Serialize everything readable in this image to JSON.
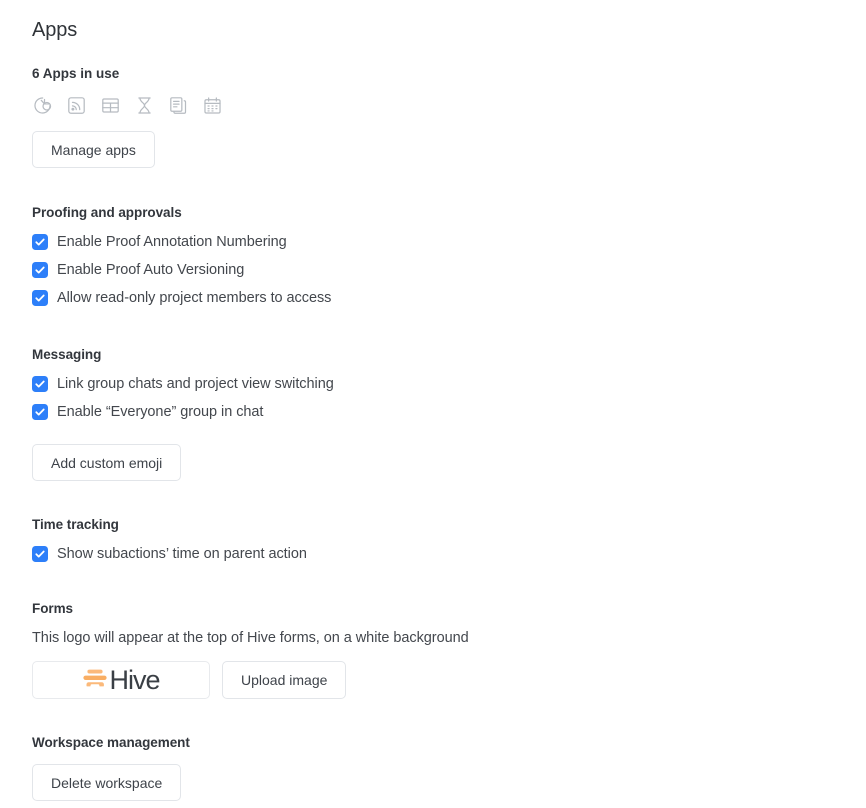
{
  "page": {
    "title": "Apps"
  },
  "apps": {
    "count_label": "6 Apps in use",
    "manage_button": "Manage apps",
    "icons": [
      {
        "name": "pie-chart-icon",
        "label": "Analytics"
      },
      {
        "name": "rss-feed-icon",
        "label": "Feed"
      },
      {
        "name": "table-grid-icon",
        "label": "Table"
      },
      {
        "name": "hourglass-icon",
        "label": "Timesheets"
      },
      {
        "name": "documents-icon",
        "label": "Notes"
      },
      {
        "name": "calendar-icon",
        "label": "Calendar"
      }
    ]
  },
  "proofing": {
    "section_label": "Proofing and approvals",
    "options": [
      {
        "label": "Enable Proof Annotation Numbering",
        "checked": true
      },
      {
        "label": "Enable Proof Auto Versioning",
        "checked": true
      },
      {
        "label": "Allow read-only project members to access",
        "checked": true
      }
    ]
  },
  "messaging": {
    "section_label": "Messaging",
    "options": [
      {
        "label": "Link group chats and project view switching",
        "checked": true
      },
      {
        "label": "Enable “Everyone” group in chat",
        "checked": true
      }
    ],
    "add_emoji_button": "Add custom emoji"
  },
  "time_tracking": {
    "section_label": "Time tracking",
    "options": [
      {
        "label": "Show subactions’ time on parent action",
        "checked": true
      }
    ]
  },
  "forms": {
    "section_label": "Forms",
    "help_text": "This logo will appear at the top of Hive forms, on a white background",
    "logo_wordmark": "Hive",
    "upload_button": "Upload image"
  },
  "workspace": {
    "section_label": "Workspace management",
    "delete_button": "Delete workspace"
  },
  "colors": {
    "checkbox_blue": "#2d7ff9",
    "logo_orange": "#fbb97a",
    "logo_orange_dark": "#f9ae63",
    "text_primary": "#33373d",
    "text_body": "#43474d",
    "border": "#e2e5e9",
    "icon_grey": "#b6bbc1"
  }
}
